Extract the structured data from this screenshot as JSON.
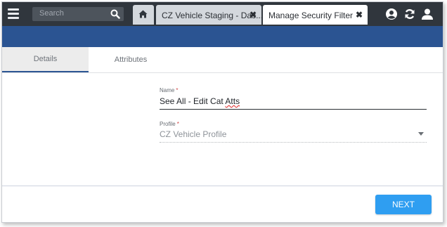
{
  "header": {
    "search_placeholder": "Search",
    "tabs": [
      {
        "label": "",
        "icon": "home-icon"
      },
      {
        "label": "CZ Vehicle Staging - Das..."
      },
      {
        "label": "Manage Security Filter"
      }
    ],
    "right_icons": [
      "globe-user-icon",
      "refresh-icon",
      "user-icon"
    ]
  },
  "subtabs": [
    "Details",
    "Attributes"
  ],
  "form": {
    "name_label": "Name",
    "name_value_prefix": "See All - Edit Cat ",
    "name_value_misspelled": "Atts",
    "profile_label": "Profile",
    "profile_value": "CZ Vehicle Profile",
    "required_mark": "*"
  },
  "footer": {
    "next_label": "NEXT"
  },
  "colors": {
    "topbar": "#30363d",
    "accent_bar": "#2b5492",
    "next_button": "#2f9ef1"
  }
}
